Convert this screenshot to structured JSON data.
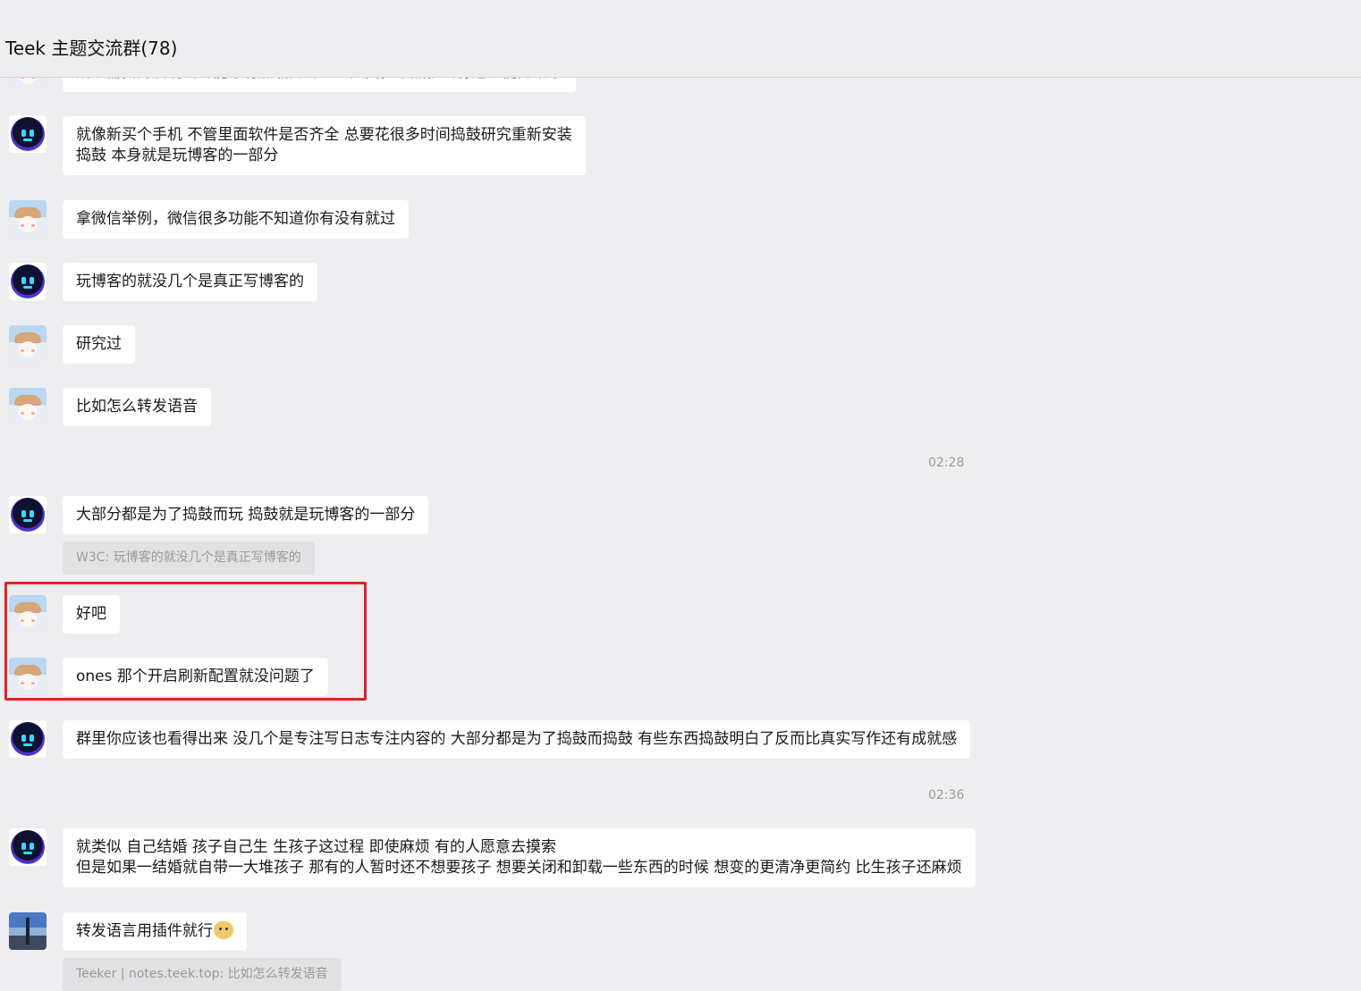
{
  "header": {
    "title": "Teek 主题交流群(78)"
  },
  "messages": [
    {
      "avatar": "girl-avatar",
      "lines": [
        "所以需要开启刷新功能才有加载完的进入页面，不然就会有这个视觉效果"
      ],
      "partial": true
    },
    {
      "avatar": "robot-avatar",
      "lines": [
        "就像新买个手机 不管里面软件是否齐全 总要花很多时间捣鼓研究重新安装",
        "捣鼓 本身就是玩博客的一部分"
      ]
    },
    {
      "avatar": "girl-avatar",
      "lines": [
        "拿微信举例，微信很多功能不知道你有没有就过"
      ]
    },
    {
      "avatar": "robot-avatar",
      "lines": [
        "玩博客的就没几个是真正写博客的"
      ]
    },
    {
      "avatar": "girl-avatar",
      "lines": [
        "研究过"
      ]
    },
    {
      "avatar": "girl-avatar",
      "lines": [
        "比如怎么转发语音"
      ]
    },
    {
      "avatar": "robot-avatar",
      "lines": [
        "大部分都是为了捣鼓而玩 捣鼓就是玩博客的一部分"
      ],
      "quote": "W3C: 玩博客的就没几个是真正写博客的"
    },
    {
      "avatar": "girl-avatar",
      "lines": [
        "好吧"
      ]
    },
    {
      "avatar": "girl-avatar",
      "lines": [
        "ones 那个开启刷新配置就没问题了"
      ]
    },
    {
      "avatar": "robot-avatar",
      "lines": [
        "群里你应该也看得出来 没几个是专注写日志专注内容的 大部分都是为了捣鼓而捣鼓 有些东西捣鼓明白了反而比真实写作还有成就感"
      ]
    },
    {
      "avatar": "robot-avatar",
      "lines": [
        "就类似 自己结婚 孩子自己生 生孩子这过程 即使麻烦 有的人愿意去摸索",
        "但是如果一结婚就自带一大堆孩子 那有的人暂时还不想要孩子 想要关闭和卸载一些东西的时候 想变的更清净更简约 比生孩子还麻烦"
      ]
    },
    {
      "avatar": "photo-avatar",
      "lines": [
        "转发语言用插件就行"
      ],
      "emoji": "cat-emoji",
      "quote": "Teeker | notes.teek.top: 比如怎么转发语音"
    }
  ],
  "timestamps": [
    "02:28",
    "02:36"
  ],
  "colors": {
    "background": "#eeedf0",
    "bubble": "#ffffff",
    "highlight": "#e32222",
    "quote_bg": "#e2e2e5"
  }
}
